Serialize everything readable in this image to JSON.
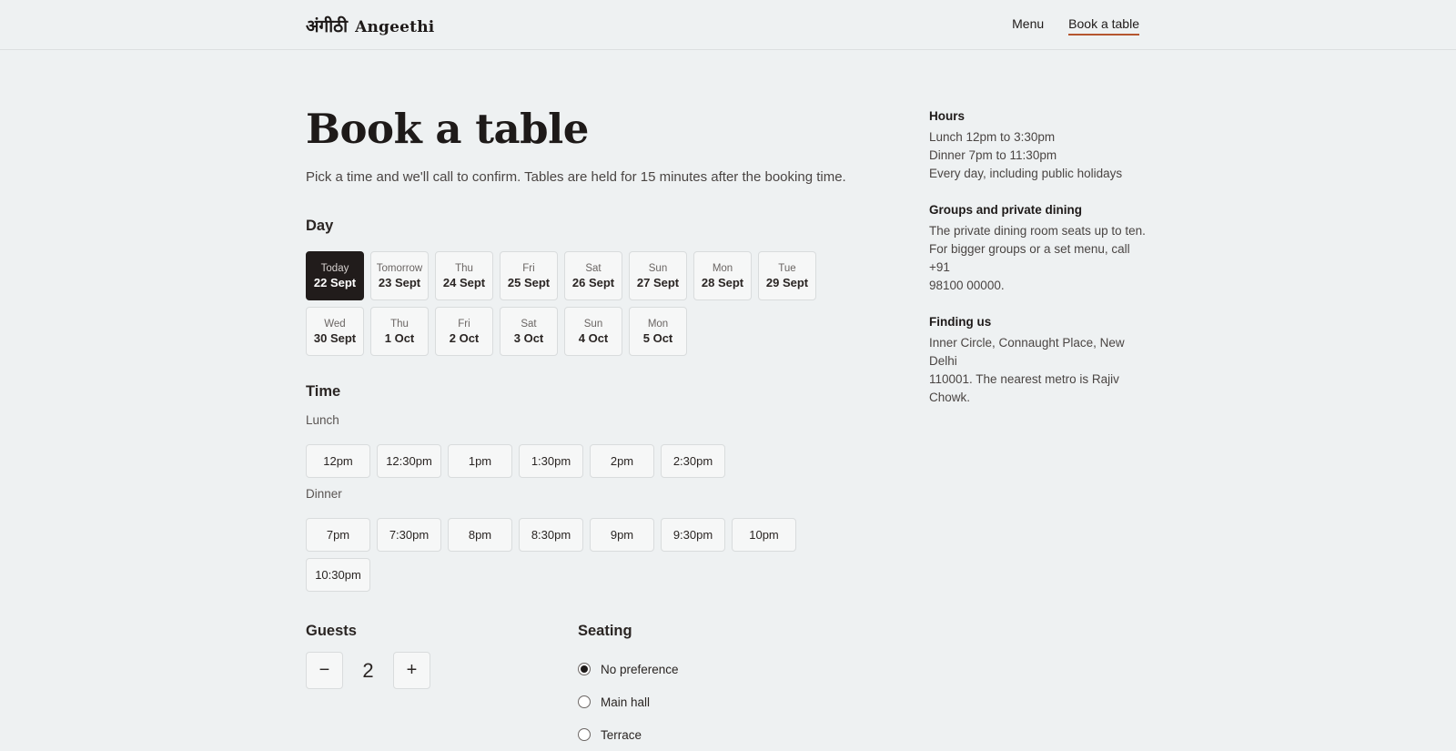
{
  "brand": {
    "hindi": "अंगीठी",
    "name": "Angeethi"
  },
  "nav": {
    "items": [
      {
        "label": "Menu"
      },
      {
        "label": "Book a table"
      }
    ]
  },
  "page": {
    "title": "Book a table",
    "lede": "Pick a time and we'll call to confirm. Tables are held for 15 minutes after the booking time."
  },
  "day": {
    "label": "Day",
    "options": [
      {
        "dow": "Today",
        "date": "22 Sept"
      },
      {
        "dow": "Tomorrow",
        "date": "23 Sept"
      },
      {
        "dow": "Thu",
        "date": "24 Sept"
      },
      {
        "dow": "Fri",
        "date": "25 Sept"
      },
      {
        "dow": "Sat",
        "date": "26 Sept"
      },
      {
        "dow": "Sun",
        "date": "27 Sept"
      },
      {
        "dow": "Mon",
        "date": "28 Sept"
      },
      {
        "dow": "Tue",
        "date": "29 Sept"
      },
      {
        "dow": "Wed",
        "date": "30 Sept"
      },
      {
        "dow": "Thu",
        "date": "1 Oct"
      },
      {
        "dow": "Fri",
        "date": "2 Oct"
      },
      {
        "dow": "Sat",
        "date": "3 Oct"
      },
      {
        "dow": "Sun",
        "date": "4 Oct"
      },
      {
        "dow": "Mon",
        "date": "5 Oct"
      }
    ]
  },
  "time": {
    "label": "Time",
    "lunch_label": "Lunch",
    "lunch": [
      "12pm",
      "12:30pm",
      "1pm",
      "1:30pm",
      "2pm",
      "2:30pm"
    ],
    "dinner_label": "Dinner",
    "dinner": [
      "7pm",
      "7:30pm",
      "8pm",
      "8:30pm",
      "9pm",
      "9:30pm",
      "10pm",
      "10:30pm"
    ]
  },
  "guests": {
    "label": "Guests",
    "minus": "−",
    "value": "2",
    "plus": "+"
  },
  "seating": {
    "label": "Seating",
    "options": [
      "No preference",
      "Main hall",
      "Terrace"
    ]
  },
  "aside": {
    "hours": {
      "title": "Hours",
      "lines": [
        "Lunch 12pm to 3:30pm",
        "Dinner 7pm to 11:30pm",
        "Every day, including public holidays"
      ]
    },
    "groups": {
      "title": "Groups and private dining",
      "lines": [
        "The private dining room seats up to ten.",
        "For bigger groups or a set menu, call +91",
        "98100 00000."
      ]
    },
    "finding": {
      "title": "Finding us",
      "lines": [
        "Inner Circle, Connaught Place, New Delhi",
        "110001. The nearest metro is Rajiv Chowk."
      ]
    }
  }
}
